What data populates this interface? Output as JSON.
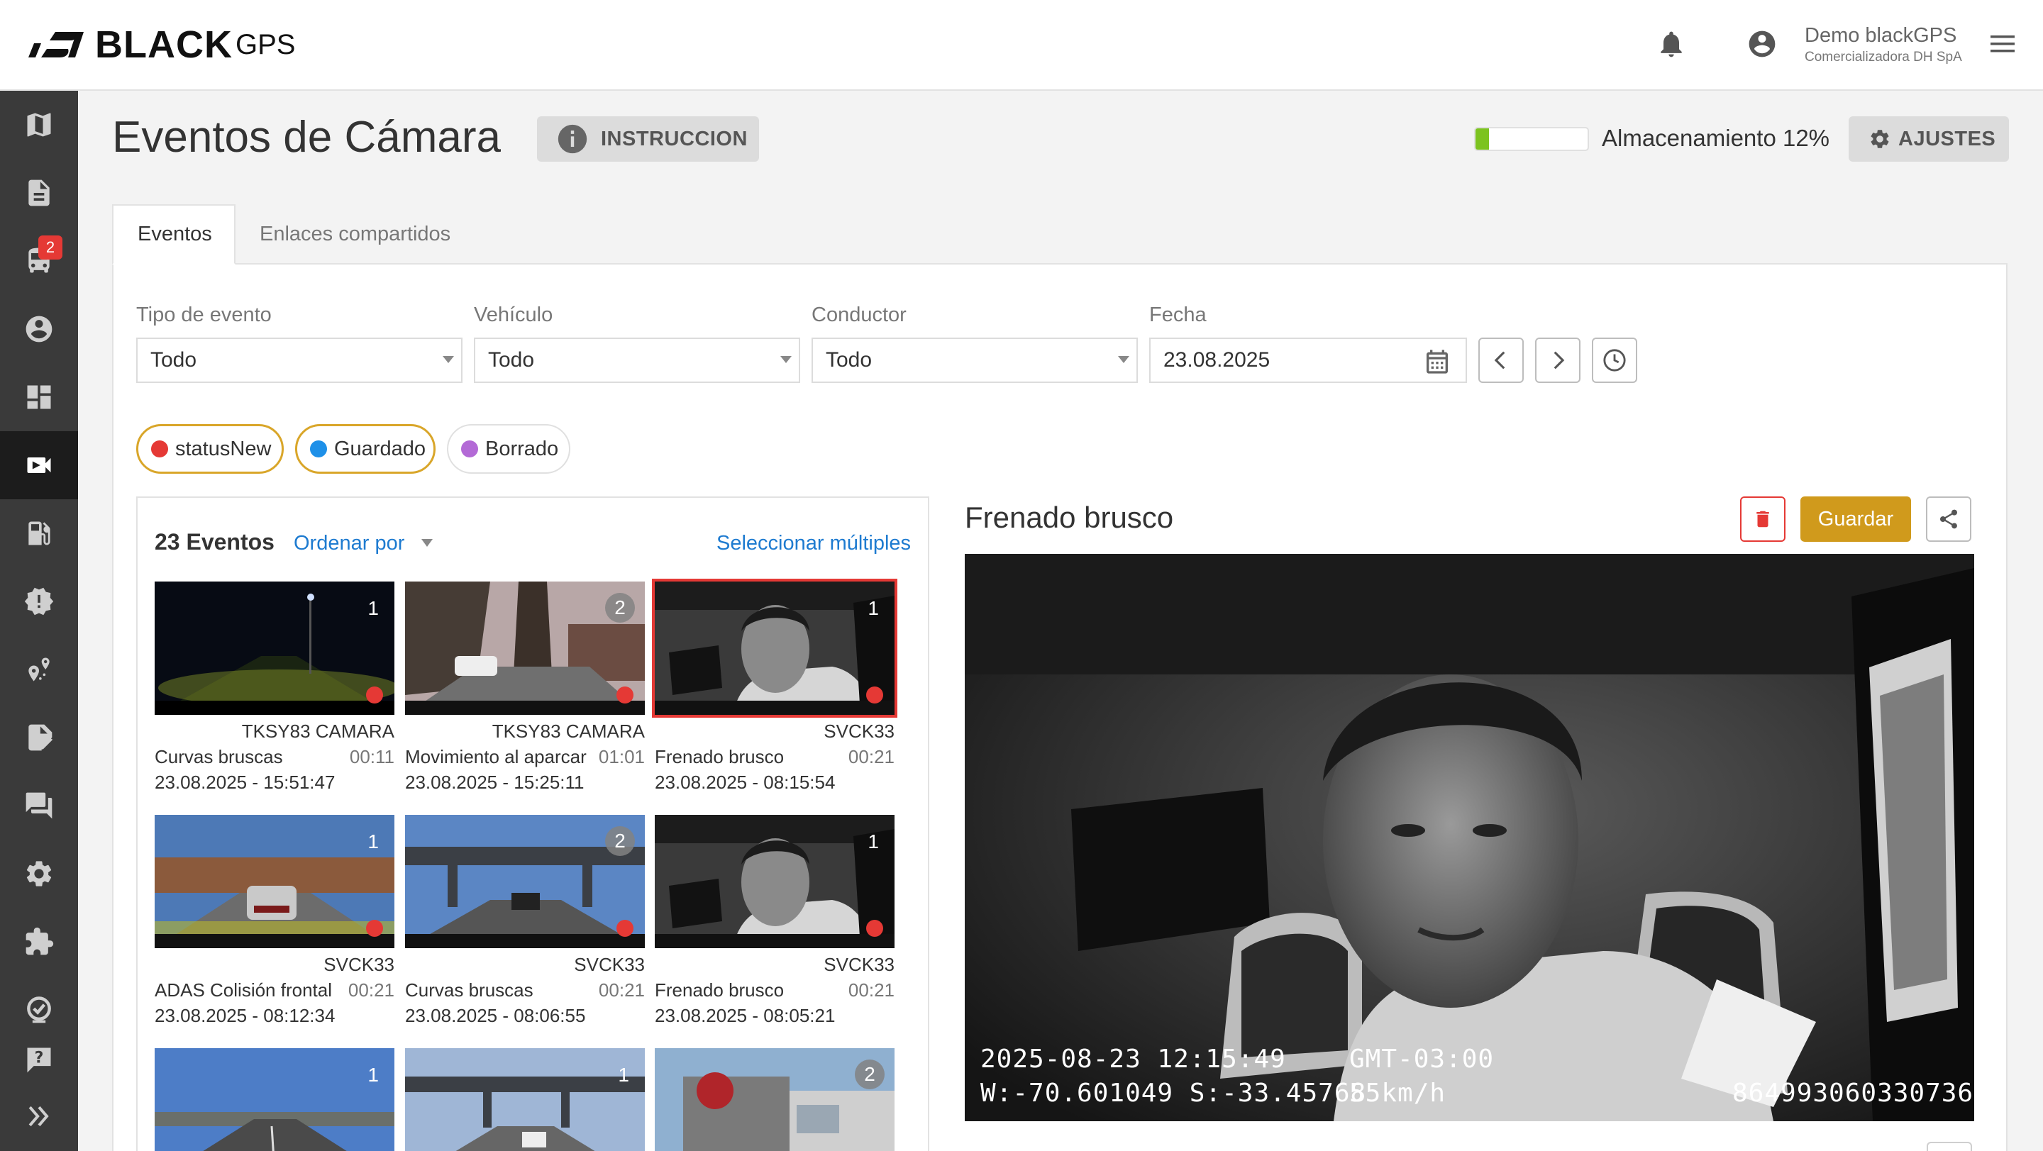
{
  "header": {
    "logo_main": "BLACK",
    "logo_sub": "GPS",
    "user_name": "Demo blackGPS",
    "user_company": "Comercializadora DH SpA"
  },
  "sidebar": {
    "items": [
      {
        "icon": "map-icon"
      },
      {
        "icon": "document-icon"
      },
      {
        "icon": "vehicle-icon",
        "badge": "2"
      },
      {
        "icon": "account-icon"
      },
      {
        "icon": "dashboard-icon"
      },
      {
        "icon": "camera-icon",
        "active": true
      },
      {
        "icon": "fuel-icon"
      },
      {
        "icon": "alert-icon"
      },
      {
        "icon": "geofence-icon"
      },
      {
        "icon": "edit-form-icon"
      },
      {
        "icon": "messages-icon"
      },
      {
        "icon": "settings-icon"
      },
      {
        "icon": "extensions-icon"
      },
      {
        "icon": "checklist-icon"
      },
      {
        "icon": "help-icon"
      },
      {
        "icon": "expand-icon"
      }
    ]
  },
  "page": {
    "title": "Eventos de Cámara",
    "instruction_label": "INSTRUCCION",
    "storage_label": "Almacenamiento 12%",
    "storage_fraction": 0.12,
    "settings_label": "AJUSTES"
  },
  "tabs": [
    {
      "label": "Eventos",
      "active": true
    },
    {
      "label": "Enlaces compartidos",
      "active": false
    }
  ],
  "filters": {
    "event_type": {
      "label": "Tipo de evento",
      "value": "Todo"
    },
    "vehicle": {
      "label": "Vehículo",
      "value": "Todo"
    },
    "driver": {
      "label": "Conductor",
      "value": "Todo"
    },
    "date": {
      "label": "Fecha",
      "value": "23.08.2025"
    }
  },
  "chips": [
    {
      "label": "statusNew",
      "color": "#e53935",
      "selected": true
    },
    {
      "label": "Guardado",
      "color": "#1e90e8",
      "selected": true
    },
    {
      "label": "Borrado",
      "color": "#b36ad6",
      "selected": false
    }
  ],
  "list": {
    "count_label": "23 Eventos",
    "order_label": "Ordenar por",
    "select_multiple_label": "Seleccionar múltiples",
    "events": [
      {
        "vehicle": "TKSY83 CAMARA",
        "type": "Curvas bruscas",
        "duration": "00:11",
        "datetime": "23.08.2025 - 15:51:47",
        "clips": "1",
        "status": "new",
        "scene": "night"
      },
      {
        "vehicle": "TKSY83 CAMARA",
        "type": "Movimiento al aparcar",
        "duration": "01:01",
        "datetime": "23.08.2025 - 15:25:11",
        "clips": "2",
        "status": "new",
        "scene": "street"
      },
      {
        "vehicle": "SVCK33",
        "type": "Frenado brusco",
        "duration": "00:21",
        "datetime": "23.08.2025 - 08:15:54",
        "clips": "1",
        "status": "new",
        "scene": "cabin",
        "selected": true
      },
      {
        "vehicle": "SVCK33",
        "type": "ADAS Colisión frontal",
        "duration": "00:21",
        "datetime": "23.08.2025 - 08:12:34",
        "clips": "1",
        "status": "new",
        "scene": "traffic"
      },
      {
        "vehicle": "SVCK33",
        "type": "Curvas bruscas",
        "duration": "00:21",
        "datetime": "23.08.2025 - 08:06:55",
        "clips": "2",
        "status": "new",
        "scene": "bridge"
      },
      {
        "vehicle": "SVCK33",
        "type": "Frenado brusco",
        "duration": "00:21",
        "datetime": "23.08.2025 - 08:05:21",
        "clips": "1",
        "status": "new",
        "scene": "cabin"
      },
      {
        "vehicle": "",
        "type": "",
        "duration": "",
        "datetime": "",
        "clips": "1",
        "status": "",
        "scene": "road"
      },
      {
        "vehicle": "",
        "type": "",
        "duration": "",
        "datetime": "",
        "clips": "1",
        "status": "",
        "scene": "bridge2"
      },
      {
        "vehicle": "",
        "type": "",
        "duration": "",
        "datetime": "",
        "clips": "2",
        "status": "",
        "scene": "truck"
      }
    ]
  },
  "detail": {
    "title": "Frenado brusco",
    "save_label": "Guardar",
    "osd": {
      "datetime": "2025-08-23  12:15:49",
      "coords": "W:-70.601049  S:-33.45768",
      "timezone": "GMT-03:00",
      "speed": "55km/h",
      "device_id": "864993060330736"
    }
  }
}
